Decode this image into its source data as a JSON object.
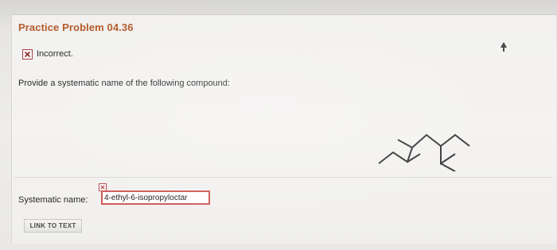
{
  "problem": {
    "title": "Practice Problem 04.36",
    "status": "Incorrect.",
    "question": "Provide a systematic name of the following compound:"
  },
  "answer": {
    "label": "Systematic name:",
    "value": "4-ethyl-6-isopropyloctar"
  },
  "buttons": {
    "link_to_text": "LINK TO TEXT"
  },
  "colors": {
    "title": "#b45c2c",
    "error": "#cf5b5b"
  },
  "icons": {
    "status": "x-mark-icon",
    "answer_status": "x-mark-icon",
    "cursor": "mouse-cursor-icon"
  }
}
